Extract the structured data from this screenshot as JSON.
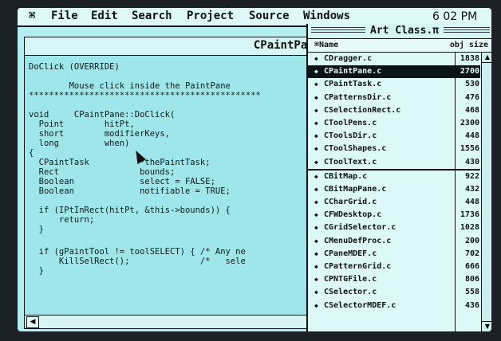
{
  "menubar": {
    "apple": "⌘",
    "items": [
      "File",
      "Edit",
      "Search",
      "Project",
      "Source",
      "Windows"
    ],
    "clock": "6 02 PM"
  },
  "editor": {
    "title": "CPaintPane.c",
    "lines": [
      "DoClick (OVERRIDE)",
      "",
      "        Mouse click inside the PaintPane",
      "**********************************************",
      "",
      "void     CPaintPane::DoClick(",
      "  Point        hitPt,",
      "  short        modifierKeys,",
      "  long         when)",
      "{",
      "  CPaintTask          *thePaintTask;",
      "  Rect                bounds;",
      "  Boolean             select = FALSE;",
      "  Boolean             notifiable = TRUE;",
      "",
      "  if (IPtInRect(hitPt, &this->bounds)) {",
      "      return;",
      "  }",
      "",
      "  if (gPaintTool != toolSELECT) { /* Any ne",
      "      KillSelRect();              /*   sele",
      "  }"
    ]
  },
  "project": {
    "title": "Art Class.π",
    "header_name": "Name",
    "header_size": "obj size",
    "files": [
      {
        "name": "CDragger.c",
        "size": "1838"
      },
      {
        "name": "CPaintPane.c",
        "size": "2700"
      },
      {
        "name": "CPaintTask.c",
        "size": "530"
      },
      {
        "name": "CPatternsDir.c",
        "size": "476"
      },
      {
        "name": "CSelectionRect.c",
        "size": "468"
      },
      {
        "name": "CToolPens.c",
        "size": "2300"
      },
      {
        "name": "CToolsDir.c",
        "size": "448"
      },
      {
        "name": "CToolShapes.c",
        "size": "1556"
      },
      {
        "name": "CToolText.c",
        "size": "430"
      },
      {
        "name": "CBitMap.c",
        "size": "922"
      },
      {
        "name": "CBitMapPane.c",
        "size": "432"
      },
      {
        "name": "CCharGrid.c",
        "size": "448"
      },
      {
        "name": "CFWDesktop.c",
        "size": "1736"
      },
      {
        "name": "CGridSelector.c",
        "size": "1028"
      },
      {
        "name": "CMenuDefProc.c",
        "size": "200"
      },
      {
        "name": "CPaneMDEF.c",
        "size": "702"
      },
      {
        "name": "CPatternGrid.c",
        "size": "666"
      },
      {
        "name": "CPNTGFile.c",
        "size": "806"
      },
      {
        "name": "CSelector.c",
        "size": "558"
      },
      {
        "name": "CSelectorMDEF.c",
        "size": "436"
      }
    ]
  },
  "colors": {
    "screen": "#b4eef0",
    "selection": "#0b1418"
  }
}
